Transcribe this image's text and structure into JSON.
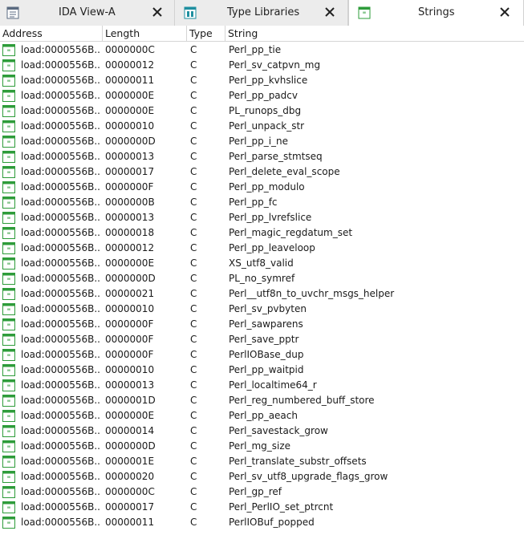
{
  "tabs": [
    {
      "label": "IDA View-A",
      "icon": "ida-view-icon",
      "active": false
    },
    {
      "label": "Type Libraries",
      "icon": "type-libraries-icon",
      "active": false
    },
    {
      "label": "Strings",
      "icon": "strings-icon",
      "active": true
    }
  ],
  "columns": {
    "address": "Address",
    "length": "Length",
    "type": "Type",
    "string": "String"
  },
  "rows": [
    {
      "address": "load:0000556B...",
      "length": "0000000C",
      "type": "C",
      "string": "Perl_pp_tie"
    },
    {
      "address": "load:0000556B...",
      "length": "00000012",
      "type": "C",
      "string": "Perl_sv_catpvn_mg"
    },
    {
      "address": "load:0000556B...",
      "length": "00000011",
      "type": "C",
      "string": "Perl_pp_kvhslice"
    },
    {
      "address": "load:0000556B...",
      "length": "0000000E",
      "type": "C",
      "string": "Perl_pp_padcv"
    },
    {
      "address": "load:0000556B...",
      "length": "0000000E",
      "type": "C",
      "string": "PL_runops_dbg"
    },
    {
      "address": "load:0000556B...",
      "length": "00000010",
      "type": "C",
      "string": "Perl_unpack_str"
    },
    {
      "address": "load:0000556B...",
      "length": "0000000D",
      "type": "C",
      "string": "Perl_pp_i_ne"
    },
    {
      "address": "load:0000556B...",
      "length": "00000013",
      "type": "C",
      "string": "Perl_parse_stmtseq"
    },
    {
      "address": "load:0000556B...",
      "length": "00000017",
      "type": "C",
      "string": "Perl_delete_eval_scope"
    },
    {
      "address": "load:0000556B...",
      "length": "0000000F",
      "type": "C",
      "string": "Perl_pp_modulo"
    },
    {
      "address": "load:0000556B...",
      "length": "0000000B",
      "type": "C",
      "string": "Perl_pp_fc"
    },
    {
      "address": "load:0000556B...",
      "length": "00000013",
      "type": "C",
      "string": "Perl_pp_lvrefslice"
    },
    {
      "address": "load:0000556B...",
      "length": "00000018",
      "type": "C",
      "string": "Perl_magic_regdatum_set"
    },
    {
      "address": "load:0000556B...",
      "length": "00000012",
      "type": "C",
      "string": "Perl_pp_leaveloop"
    },
    {
      "address": "load:0000556B...",
      "length": "0000000E",
      "type": "C",
      "string": "XS_utf8_valid"
    },
    {
      "address": "load:0000556B...",
      "length": "0000000D",
      "type": "C",
      "string": "PL_no_symref"
    },
    {
      "address": "load:0000556B...",
      "length": "00000021",
      "type": "C",
      "string": "Perl__utf8n_to_uvchr_msgs_helper"
    },
    {
      "address": "load:0000556B...",
      "length": "00000010",
      "type": "C",
      "string": "Perl_sv_pvbyten"
    },
    {
      "address": "load:0000556B...",
      "length": "0000000F",
      "type": "C",
      "string": "Perl_sawparens"
    },
    {
      "address": "load:0000556B...",
      "length": "0000000F",
      "type": "C",
      "string": "Perl_save_pptr"
    },
    {
      "address": "load:0000556B...",
      "length": "0000000F",
      "type": "C",
      "string": "PerlIOBase_dup"
    },
    {
      "address": "load:0000556B...",
      "length": "00000010",
      "type": "C",
      "string": "Perl_pp_waitpid"
    },
    {
      "address": "load:0000556B...",
      "length": "00000013",
      "type": "C",
      "string": "Perl_localtime64_r"
    },
    {
      "address": "load:0000556B...",
      "length": "0000001D",
      "type": "C",
      "string": "Perl_reg_numbered_buff_store"
    },
    {
      "address": "load:0000556B...",
      "length": "0000000E",
      "type": "C",
      "string": "Perl_pp_aeach"
    },
    {
      "address": "load:0000556B...",
      "length": "00000014",
      "type": "C",
      "string": "Perl_savestack_grow"
    },
    {
      "address": "load:0000556B...",
      "length": "0000000D",
      "type": "C",
      "string": "Perl_mg_size"
    },
    {
      "address": "load:0000556B...",
      "length": "0000001E",
      "type": "C",
      "string": "Perl_translate_substr_offsets"
    },
    {
      "address": "load:0000556B...",
      "length": "00000020",
      "type": "C",
      "string": "Perl_sv_utf8_upgrade_flags_grow"
    },
    {
      "address": "load:0000556B...",
      "length": "0000000C",
      "type": "C",
      "string": "Perl_gp_ref"
    },
    {
      "address": "load:0000556B...",
      "length": "00000017",
      "type": "C",
      "string": "Perl_PerlIO_set_ptrcnt"
    },
    {
      "address": "load:0000556B...",
      "length": "00000011",
      "type": "C",
      "string": "PerlIOBuf_popped"
    }
  ],
  "colors": {
    "string_icon_green": "#2e9c3a",
    "tab_icon_teal": "#1f8fa0"
  }
}
